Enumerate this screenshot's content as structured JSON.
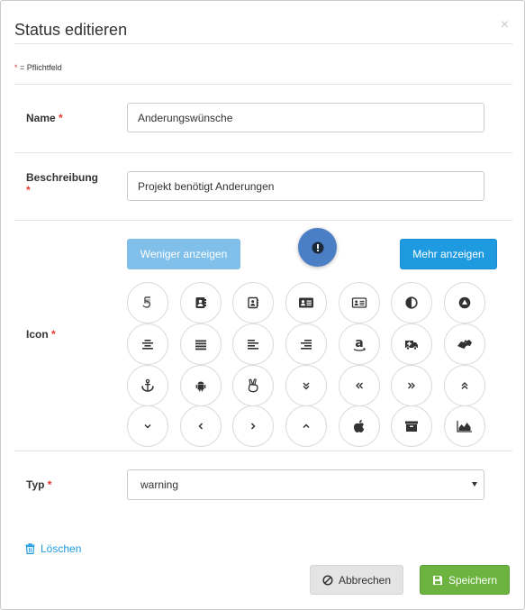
{
  "modal": {
    "title": "Status editieren",
    "close_symbol": "×",
    "required_note_star": "*",
    "required_note_text": " = Pflichtfeld"
  },
  "fields": {
    "name_label": "Name",
    "name_value": "Anderungswünsche",
    "description_label": "Beschreibung",
    "description_value": "Projekt benötigt Anderungen",
    "icon_label": "Icon",
    "type_label": "Typ",
    "type_value": "warning",
    "required_star": "*"
  },
  "icon_picker": {
    "less_label": "Weniger anzeigen",
    "more_label": "Mehr anzeigen",
    "selected_icon": "exclamation-circle-icon",
    "rows": [
      [
        "500px-icon",
        "address-book-icon",
        "address-book-o-icon",
        "address-card-icon",
        "address-card-o-icon",
        "adjust-icon",
        "adn-icon"
      ],
      [
        "align-center-icon",
        "align-justify-icon",
        "align-left-icon",
        "align-right-icon",
        "amazon-icon",
        "ambulance-icon",
        "american-sign-language-interpreting-icon"
      ],
      [
        "anchor-icon",
        "android-icon",
        "angellist-icon",
        "angle-double-down-icon",
        "angle-double-left-icon",
        "angle-double-right-icon",
        "angle-double-up-icon"
      ],
      [
        "angle-down-icon",
        "angle-left-icon",
        "angle-right-icon",
        "angle-up-icon",
        "apple-icon",
        "archive-icon",
        "area-chart-icon"
      ]
    ]
  },
  "footer": {
    "delete_label": "Löschen",
    "cancel_label": "Abbrechen",
    "save_label": "Speichern"
  },
  "colors": {
    "primary": "#1e9be0",
    "primary_light": "#7fbfe9",
    "success": "#6cb33f",
    "required": "#e53935",
    "selected_icon_bg": "#4a7fc5"
  }
}
